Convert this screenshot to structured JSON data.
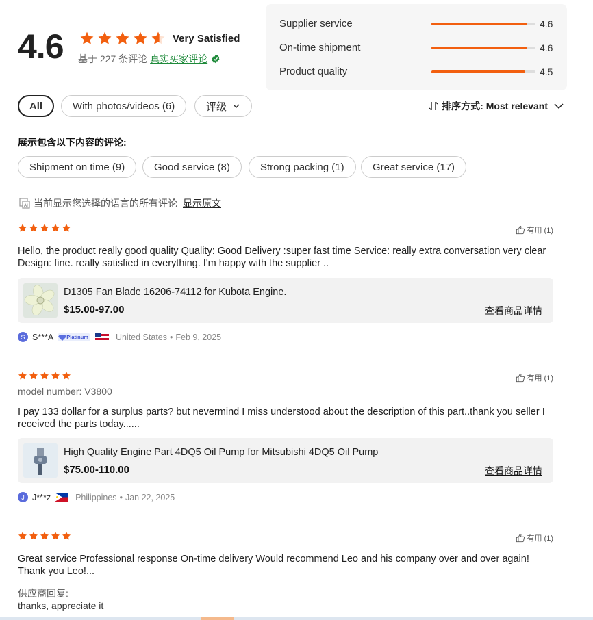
{
  "summary": {
    "score": "4.6",
    "rating": 4.6,
    "satisfaction": "Very Satisfied",
    "based_on": "基于 227 条评论",
    "verified_label": "真实买家评论"
  },
  "scores": [
    {
      "label": "Supplier service",
      "value": "4.6",
      "fraction": 0.92
    },
    {
      "label": "On-time shipment",
      "value": "4.6",
      "fraction": 0.92
    },
    {
      "label": "Product quality",
      "value": "4.5",
      "fraction": 0.9
    }
  ],
  "filters": {
    "all": "All",
    "photos": "With photos/videos (6)",
    "rating": "评级"
  },
  "sort": {
    "label": "排序方式:",
    "value": "Most relevant"
  },
  "topics": {
    "title": "展示包含以下内容的评论:",
    "items": [
      "Shipment on time (9)",
      "Good service (8)",
      "Strong packing (1)",
      "Great service (17)"
    ]
  },
  "translation": {
    "notice": "当前显示您选择的语言的所有评论",
    "link": "显示原文"
  },
  "reviews": [
    {
      "stars": 5,
      "helpful": "有用 (1)",
      "text": "Hello, the product really good quality Quality: Good Delivery :super fast time Service: really extra conversation very clear Design: fine. really satisfied in everything. I'm happy with the supplier ..",
      "product_name": "D1305 Fan Blade 16206-74112 for Kubota Engine.",
      "price": "$15.00-97.00",
      "details_link": "查看商品详情",
      "initial": "S",
      "reviewer": "S***A",
      "badge": "Platinum",
      "country": "United States",
      "date": "Feb 9, 2025"
    },
    {
      "stars": 5,
      "helpful": "有用 (1)",
      "model_label": "model number:",
      "model_value": "V3800",
      "text": "I pay 133 dollar for a surplus parts? but nevermind I miss understood about the description of this part..thank you seller I received the parts today......",
      "product_name": "High Quality Engine Part 4DQ5 Oil Pump for Mitsubishi 4DQ5 Oil Pump",
      "price": "$75.00-110.00",
      "details_link": "查看商品详情",
      "initial": "J",
      "reviewer": "J***z",
      "country": "Philippines",
      "date": "Jan 22, 2025"
    },
    {
      "stars": 5,
      "helpful": "有用 (1)",
      "text": "Great service Professional response On-time delivery Would recommend Leo and his company over and over again! Thank you Leo!...",
      "reply_label": "供应商回复:",
      "reply_text": "thanks, appreciate it"
    }
  ],
  "colors": {
    "star": "#f25f0f",
    "bar": "#f25f0f",
    "verified": "#1e8a3a"
  }
}
